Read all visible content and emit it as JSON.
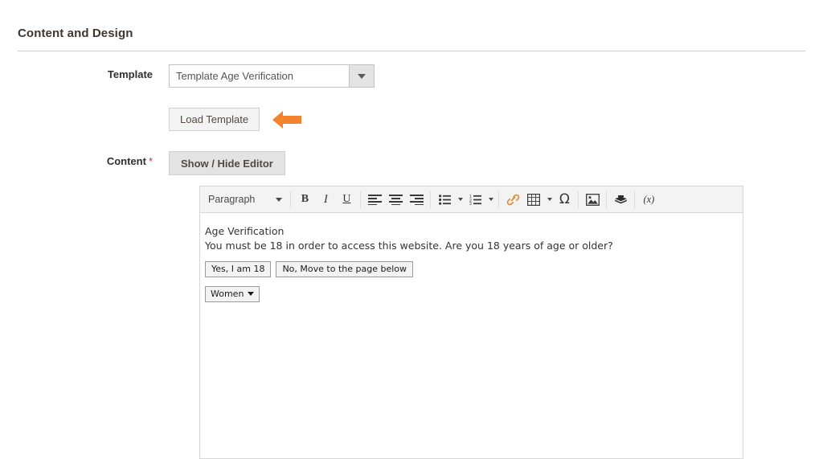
{
  "section": {
    "title": "Content and Design"
  },
  "fields": {
    "template": {
      "label": "Template",
      "selected_value": "Template Age Verification",
      "dropdown_icon": "chevron-down-icon"
    },
    "load_template": {
      "button_label": "Load Template",
      "annotation_icon": "left-arrow-annotation",
      "annotation_color": "#f5822d"
    },
    "content": {
      "label": "Content",
      "required_marker": "*",
      "required_color": "#e02b27",
      "toggle_button_label": "Show / Hide Editor"
    }
  },
  "editor": {
    "toolbar": [
      {
        "name": "format-select",
        "label": "Paragraph",
        "type": "select"
      },
      {
        "name": "separator-1",
        "type": "separator"
      },
      {
        "name": "bold-icon",
        "label": "B",
        "type": "button"
      },
      {
        "name": "italic-icon",
        "label": "I",
        "type": "button"
      },
      {
        "name": "underline-icon",
        "label": "U",
        "type": "button"
      },
      {
        "name": "separator-2",
        "type": "separator"
      },
      {
        "name": "align-left-icon",
        "type": "button"
      },
      {
        "name": "align-center-icon",
        "type": "button"
      },
      {
        "name": "align-right-icon",
        "type": "button"
      },
      {
        "name": "separator-3",
        "type": "separator"
      },
      {
        "name": "bullet-list-icon",
        "type": "split-button"
      },
      {
        "name": "numbered-list-icon",
        "type": "split-button"
      },
      {
        "name": "separator-4",
        "type": "separator"
      },
      {
        "name": "link-icon",
        "type": "button"
      },
      {
        "name": "table-icon",
        "type": "split-button"
      },
      {
        "name": "special-character-icon",
        "label": "Ω",
        "type": "button"
      },
      {
        "name": "separator-5",
        "type": "separator"
      },
      {
        "name": "insert-image-icon",
        "type": "button"
      },
      {
        "name": "separator-6",
        "type": "separator"
      },
      {
        "name": "insert-widget-icon",
        "type": "button"
      },
      {
        "name": "separator-7",
        "type": "separator"
      },
      {
        "name": "insert-variable-icon",
        "label": "(x)",
        "type": "button"
      }
    ],
    "content": {
      "heading": "Age Verification",
      "paragraph": "You must be 18 in order to access this website. Are you 18 years of age or older?",
      "buttons": [
        "Yes, I am 18",
        "No, Move to the page below"
      ],
      "select": {
        "value": "Women",
        "caret_icon": "caret-down-icon"
      }
    }
  }
}
